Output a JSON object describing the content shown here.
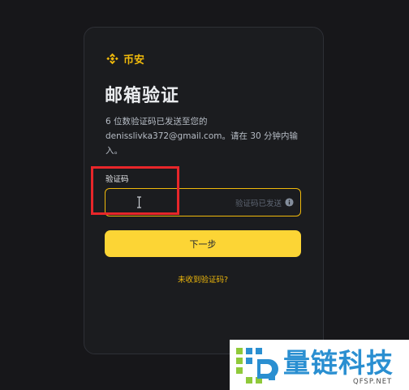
{
  "brand": {
    "name": "币安",
    "logo_icon": "binance-logo-icon",
    "accent": "#f0b90b"
  },
  "page": {
    "title": "邮箱验证",
    "desc_line1": "6 位数验证码已发送至您的",
    "desc_line2": "denisslivka372@gmail.com。请在 30 分钟内输",
    "desc_line3": "入。"
  },
  "code_field": {
    "label": "验证码",
    "value": "",
    "status": "验证码已发送",
    "status_icon": "info-icon",
    "cursor_icon": "text-cursor-icon"
  },
  "actions": {
    "next_label": "下一步",
    "resend_label": "未收到验证码?",
    "button_color": "#fcd535"
  },
  "annotation": {
    "color": "#e8262a"
  },
  "watermark": {
    "name_cn": "量链科技",
    "domain": "QFSP.NET",
    "logo_icon": "qfsp-logo-icon",
    "color": "#2a8fd1"
  }
}
